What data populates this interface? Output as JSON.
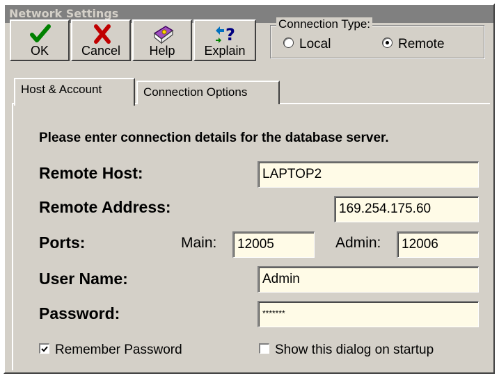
{
  "window": {
    "title": "Network Settings"
  },
  "toolbar": {
    "ok_label": "OK",
    "cancel_label": "Cancel",
    "help_label": "Help",
    "explain_label": "Explain"
  },
  "connection_type": {
    "title": "Connection Type:",
    "options": [
      {
        "label": "Local",
        "selected": false
      },
      {
        "label": "Remote",
        "selected": true
      }
    ]
  },
  "tabs": [
    {
      "label": "Host & Account",
      "active": true
    },
    {
      "label": "Connection Options",
      "active": false
    }
  ],
  "form": {
    "intro": "Please enter connection details for the database server.",
    "remote_host_label": "Remote Host:",
    "remote_host_value": "LAPTOP2",
    "remote_address_label": "Remote Address:",
    "remote_address_value": "169.254.175.60",
    "ports_label": "Ports:",
    "main_label": "Main:",
    "main_value": "12005",
    "admin_label": "Admin:",
    "admin_value": "12006",
    "user_name_label": "User Name:",
    "user_name_value": "Admin",
    "password_label": "Password:",
    "password_value": "*******"
  },
  "checkboxes": {
    "remember_password": {
      "label": "Remember Password",
      "checked": true
    },
    "show_on_startup": {
      "label": "Show this dialog on startup",
      "checked": false
    }
  },
  "icons": [
    "checkmark-icon",
    "x-icon",
    "book-icon",
    "question-arrows-icon"
  ],
  "colors": {
    "ok_green": "#008000",
    "cancel_red": "#c00000",
    "field_bg": "#fffbe7",
    "dialog_bg": "#d4d0c8"
  }
}
